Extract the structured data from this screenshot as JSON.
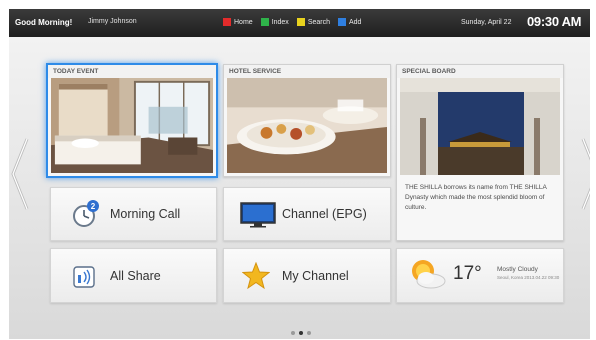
{
  "topbar": {
    "greeting": "Good Morning!",
    "user": "Jimmy Johnson",
    "legend": [
      {
        "label": "Home",
        "color": "#e32b2b"
      },
      {
        "label": "Index",
        "color": "#2fb34a"
      },
      {
        "label": "Search",
        "color": "#e8d21e"
      },
      {
        "label": "Add",
        "color": "#2f7fe0"
      }
    ],
    "date": "Sunday, April 22",
    "time": "09:30 AM"
  },
  "cards": {
    "today_event": {
      "title": "TODAY EVENT"
    },
    "hotel_service": {
      "title": "HOTEL SERVICE"
    },
    "special_board": {
      "title": "SPECIAL BOARD",
      "text": "THE SHILLA borrows its name from THE SHILLA Dynasty which made the most splendid bloom of culture."
    }
  },
  "tiles": {
    "morning_call": {
      "label": "Morning Call",
      "badge": "2"
    },
    "channel_epg": {
      "label": "Channel (EPG)"
    },
    "all_share": {
      "label": "All Share"
    },
    "my_channel": {
      "label": "My Channel"
    },
    "weather": {
      "temp": "17°",
      "desc": "Mostly Cloudy",
      "location": "Seoul, Korea 2013.04.22 09:30"
    }
  },
  "pagination": {
    "pages": 3,
    "active": 2
  }
}
